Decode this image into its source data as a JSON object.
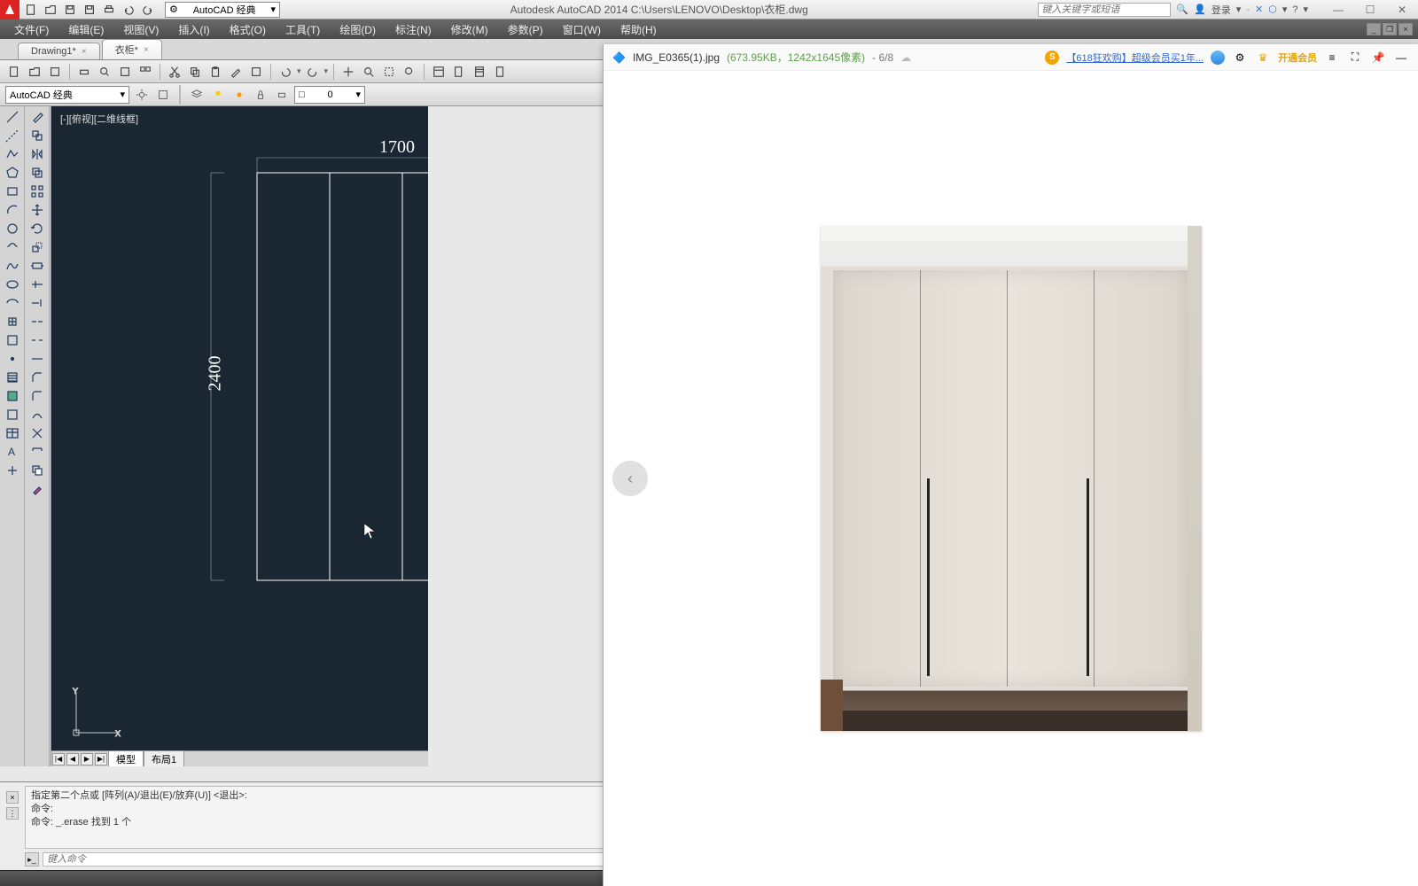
{
  "titlebar": {
    "workspace_menu": "AutoCAD 经典",
    "app_title": "Autodesk AutoCAD 2014     C:\\Users\\LENOVO\\Desktop\\衣柜.dwg",
    "search_placeholder": "键入关键字或短语",
    "login": "登录"
  },
  "menus": [
    "文件(F)",
    "编辑(E)",
    "视图(V)",
    "插入(I)",
    "格式(O)",
    "工具(T)",
    "绘图(D)",
    "标注(N)",
    "修改(M)",
    "参数(P)",
    "窗口(W)",
    "帮助(H)"
  ],
  "doc_tabs": [
    {
      "label": "Drawing1*",
      "active": false
    },
    {
      "label": "衣柜*",
      "active": true
    }
  ],
  "layerbar": {
    "workspace": "AutoCAD 经典",
    "layer_display": "0"
  },
  "viewport": {
    "label": "[-][俯视][二维线框]",
    "dim_width": "1700",
    "dim_height": "2400",
    "ucs_x": "X",
    "ucs_y": "Y"
  },
  "layout_tabs": {
    "model": "模型",
    "layout1": "布局1"
  },
  "command": {
    "line1": "指定第二个点或 [阵列(A)/退出(E)/放弃(U)] <退出>:",
    "line2": "命令:",
    "line3": "命令: _.erase 找到 1 个",
    "prompt_placeholder": "键入命令"
  },
  "imgviewer": {
    "filename": "IMG_E0365(1).jpg",
    "meta": "(673.95KB，1242x1645像素)",
    "count": "- 6/8",
    "promo1": "【618狂欢购】超级会员买1年...",
    "vip": "开通会员",
    "prev": "‹"
  }
}
